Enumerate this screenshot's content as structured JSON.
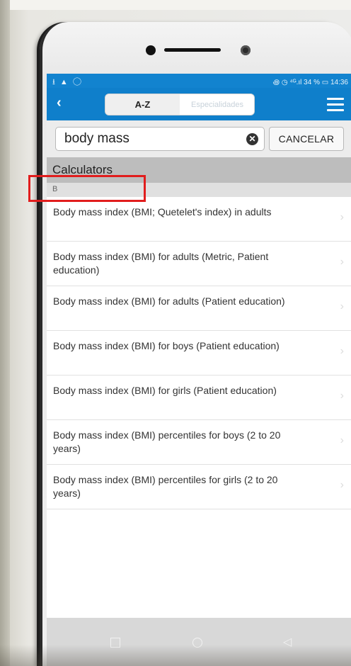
{
  "status_bar": {
    "left_icons": "⭳ ▲ ◯",
    "right_text": "꩜ ◷ ⁴ᴳ.ıl 34 % ▭ 14:36"
  },
  "toolbar": {
    "back_label": "‹",
    "tab_az": "A-Z",
    "tab_specialties": "Especialidades"
  },
  "search": {
    "value": "body mass",
    "clear_icon": "close-circle-icon",
    "cancel_label": "CANCELAR"
  },
  "results": {
    "section_title": "Calculators",
    "letter": "B",
    "items": [
      "Body mass index (BMI; Quetelet's index) in adults",
      "Body mass index (BMI) for adults (Metric, Patient education)",
      "Body mass index (BMI) for adults (Patient education)",
      "Body mass index (BMI) for boys (Patient education)",
      "Body mass index (BMI) for girls (Patient education)",
      "Body mass index (BMI) percentiles for boys (2 to 20 years)",
      "Body mass index (BMI) percentiles for girls (2 to 20 years)"
    ]
  },
  "colors": {
    "toolbar": "#0f7fcb",
    "highlight": "#e11d1d"
  }
}
